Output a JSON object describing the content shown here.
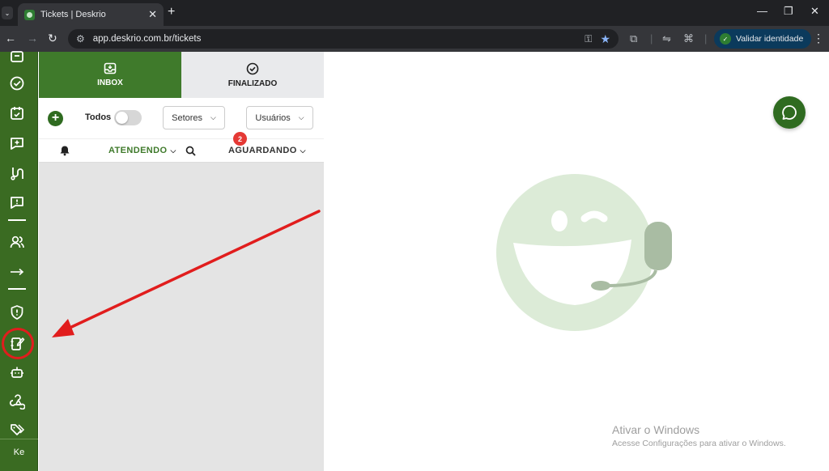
{
  "browser": {
    "tab_title": "Tickets | Deskrio",
    "url": "app.deskrio.com.br/tickets",
    "validate_label": "Validar identidade"
  },
  "sidebar": {
    "user_initials": "Ke"
  },
  "panel": {
    "tabs": [
      {
        "label": "INBOX"
      },
      {
        "label": "FINALIZADO"
      }
    ],
    "filters": {
      "todos_label": "Todos",
      "setores_label": "Setores",
      "usuarios_label": "Usuários"
    },
    "queue": {
      "atendendo_label": "ATENDENDO",
      "aguardando_label": "AGUARDANDO",
      "aguardando_count": "2"
    }
  },
  "watermark": {
    "title": "Ativar o Windows",
    "subtitle": "Acesse Configurações para ativar o Windows."
  },
  "colors": {
    "sidebar": "#3a6b22",
    "accent": "#3f7a2b",
    "annotation": "#e11d1d"
  }
}
